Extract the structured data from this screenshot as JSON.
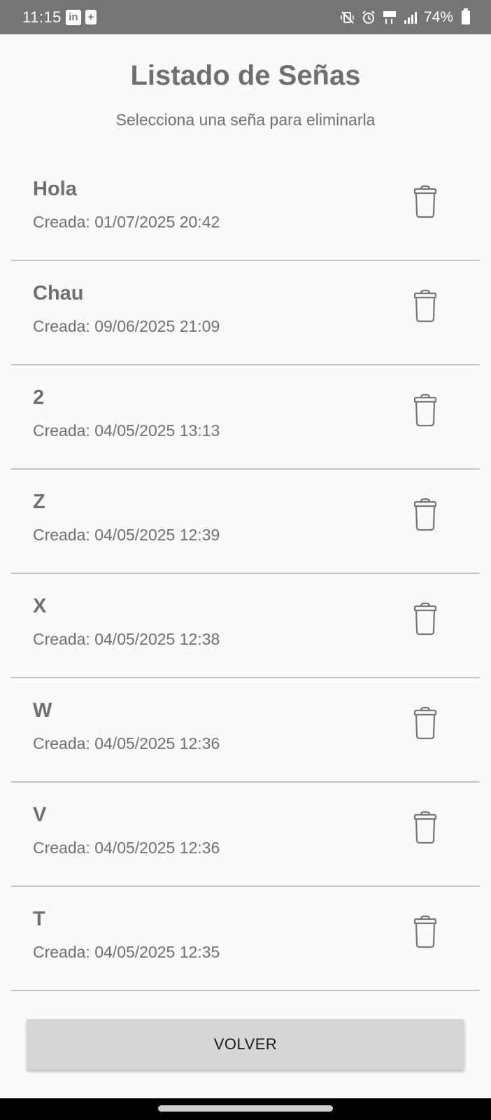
{
  "status_bar": {
    "time": "11:15",
    "app_icon_linkedin": "in",
    "app_icon_plus": "+",
    "battery_text": "74%"
  },
  "header": {
    "title": "Listado de Señas",
    "subtitle": "Selecciona una seña para eliminarla"
  },
  "signs": [
    {
      "name": "Hola",
      "created": "Creada: 01/07/2025 20:42"
    },
    {
      "name": "Chau",
      "created": "Creada: 09/06/2025 21:09"
    },
    {
      "name": "2",
      "created": "Creada: 04/05/2025 13:13"
    },
    {
      "name": "Z",
      "created": "Creada: 04/05/2025 12:39"
    },
    {
      "name": "X",
      "created": "Creada: 04/05/2025 12:38"
    },
    {
      "name": "W",
      "created": "Creada: 04/05/2025 12:36"
    },
    {
      "name": "V",
      "created": "Creada: 04/05/2025 12:36"
    },
    {
      "name": "T",
      "created": "Creada: 04/05/2025 12:35"
    }
  ],
  "actions": {
    "back_label": "VOLVER"
  },
  "icons": {
    "delete": "trash-icon"
  },
  "colors": {
    "status_bar": "#757575",
    "background": "#fafafa",
    "text": "#6f6f6f",
    "divider": "#c4c4c4",
    "button": "#d6d6d6"
  }
}
